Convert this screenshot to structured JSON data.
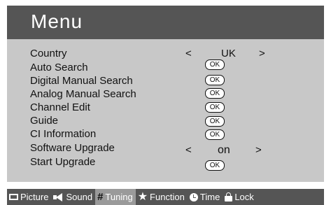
{
  "menu": {
    "title": "Menu",
    "items": [
      {
        "label": "Country",
        "control": "select",
        "value": "UK",
        "left": "<",
        "right": ">"
      },
      {
        "label": "Auto Search",
        "control": "ok",
        "ok": "OK"
      },
      {
        "label": "Digital Manual Search",
        "control": "ok",
        "ok": "OK"
      },
      {
        "label": "Analog Manual Search",
        "control": "ok",
        "ok": "OK"
      },
      {
        "label": "Channel Edit",
        "control": "ok",
        "ok": "OK"
      },
      {
        "label": "Guide",
        "control": "ok",
        "ok": "OK"
      },
      {
        "label": "CI Information",
        "control": "ok",
        "ok": "OK"
      },
      {
        "label": "Software Upgrade",
        "control": "select",
        "value": "on",
        "left": "<",
        "right": ">"
      },
      {
        "label": "Start Upgrade",
        "control": "ok",
        "ok": "OK"
      }
    ]
  },
  "tabs": [
    {
      "label": "Picture",
      "icon": "picture-icon"
    },
    {
      "label": "Sound",
      "icon": "speaker-icon"
    },
    {
      "label": "Tuning",
      "icon": "grid-icon",
      "active": true
    },
    {
      "label": "Function",
      "icon": "star-icon"
    },
    {
      "label": "Time",
      "icon": "clock-icon"
    },
    {
      "label": "Lock",
      "icon": "lock-icon"
    }
  ],
  "colors": {
    "header_bg": "#555555",
    "panel_bg": "#c8c8c8",
    "active_tab_bg": "#9a9a9a"
  }
}
